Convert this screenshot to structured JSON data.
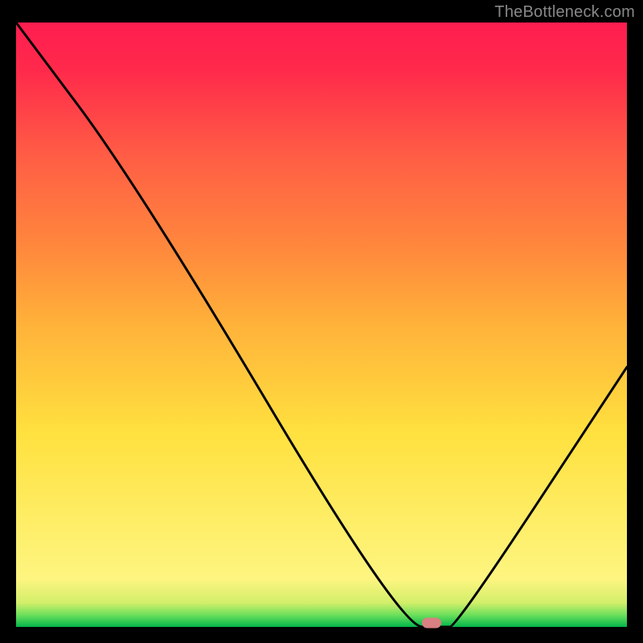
{
  "watermark": "TheBottleneck.com",
  "chart_data": {
    "type": "line",
    "title": "",
    "xlabel": "",
    "ylabel": "",
    "xlim": [
      0,
      100
    ],
    "ylim": [
      0,
      100
    ],
    "grid": false,
    "x": [
      0,
      20,
      63,
      70,
      72,
      100
    ],
    "y": [
      100,
      73,
      0,
      0,
      0,
      43
    ],
    "marker_x": 68,
    "marker_y": 0,
    "annotations": []
  }
}
